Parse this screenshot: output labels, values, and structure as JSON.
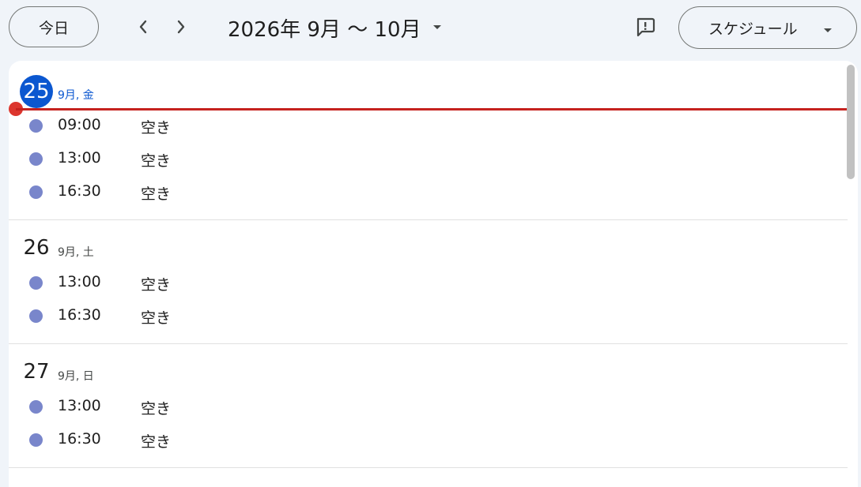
{
  "toolbar": {
    "today_label": "今日",
    "prev_icon": "chevron-left-icon",
    "next_icon": "chevron-right-icon",
    "range_title": "2026年 9月 〜 10月",
    "feedback_icon": "feedback-icon",
    "view_label": "スケジュール"
  },
  "colors": {
    "accent": "#0b57d0",
    "event_dot": "#7986cb",
    "now_line": "#c5221f"
  },
  "days": [
    {
      "date": "25",
      "sub": "9月, 金",
      "is_today": true,
      "events": [
        {
          "time": "09:00",
          "title": "空き"
        },
        {
          "time": "13:00",
          "title": "空き"
        },
        {
          "time": "16:30",
          "title": "空き"
        }
      ]
    },
    {
      "date": "26",
      "sub": "9月, 土",
      "is_today": false,
      "events": [
        {
          "time": "13:00",
          "title": "空き"
        },
        {
          "time": "16:30",
          "title": "空き"
        }
      ]
    },
    {
      "date": "27",
      "sub": "9月, 日",
      "is_today": false,
      "events": [
        {
          "time": "13:00",
          "title": "空き"
        },
        {
          "time": "16:30",
          "title": "空き"
        }
      ]
    }
  ]
}
